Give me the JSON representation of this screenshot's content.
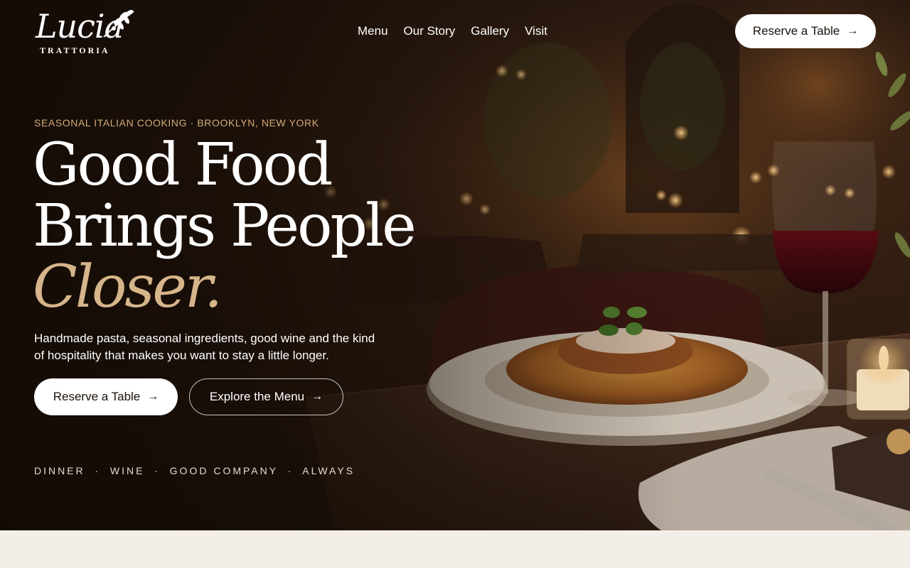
{
  "brand": {
    "logo_name": "Lucia",
    "logo_sub": "TRATTORIA"
  },
  "nav": {
    "items": [
      "Menu",
      "Our Story",
      "Gallery",
      "Visit"
    ],
    "reserve_label": "Reserve a Table"
  },
  "hero": {
    "eyebrow": "SEASONAL ITALIAN COOKING · BROOKLYN, NEW YORK",
    "headline_line1": "Good Food",
    "headline_line2": "Brings People",
    "headline_accent": "Closer.",
    "lede": "Handmade pasta, seasonal ingredients, good wine and the kind of hospitality that makes you want to stay a little longer.",
    "primary_cta": "Reserve a Table",
    "secondary_cta": "Explore the Menu",
    "tagline": "DINNER  ·  WINE  ·  GOOD COMPANY  ·  ALWAYS"
  },
  "icons": {
    "arrow": "arrow-right-icon",
    "logo_branch": "olive-branch-icon"
  },
  "colors": {
    "accent_gold": "#d3ac78",
    "accent_script": "#d6b58a",
    "page_bg": "#f3eee8",
    "button_bg": "#ffffff"
  }
}
